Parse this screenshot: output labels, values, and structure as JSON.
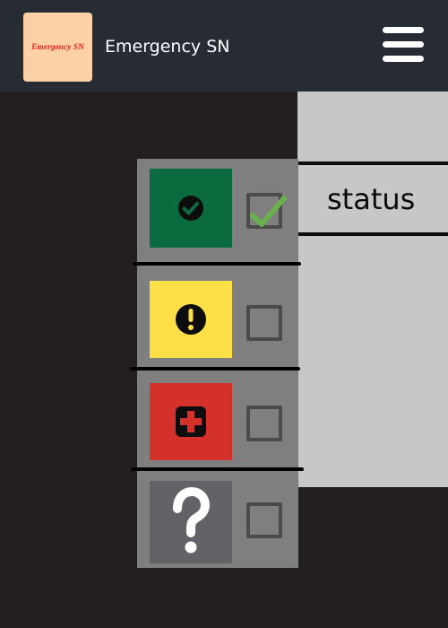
{
  "header": {
    "logo_text": "Emergency SN",
    "app_title": "Emergency SN",
    "menu_icon": "hamburger-menu-icon"
  },
  "status_panel": {
    "label": "status"
  },
  "status_options": [
    {
      "icon": "check-circle-icon",
      "color": "#0a6b3e",
      "checked": true,
      "check_color": "#6ab04c"
    },
    {
      "icon": "exclamation-circle-icon",
      "color": "#fde047",
      "checked": false
    },
    {
      "icon": "medical-cross-icon",
      "color": "#d3312a",
      "checked": false
    },
    {
      "icon": "question-mark-icon",
      "color": "#626367",
      "checked": false
    }
  ]
}
